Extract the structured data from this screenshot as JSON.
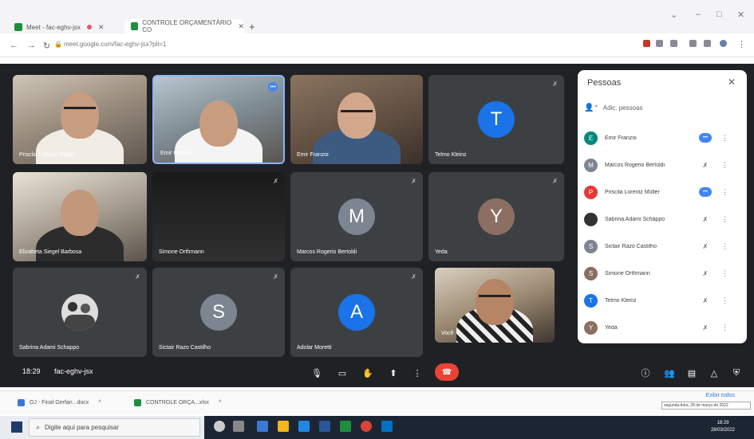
{
  "browser": {
    "tabs": [
      {
        "label": "Meet - fac-eghv-jsx",
        "active": false
      },
      {
        "label": "CONTROLE ORÇAMENTÁRIO CO",
        "active": true
      }
    ],
    "new_tab": "+",
    "url": "meet.google.com/fac-eghv-jsx?pli=1"
  },
  "tiles": [
    {
      "name": "Priscila Lorentz Müller",
      "kind": "video",
      "status": "speaking"
    },
    {
      "name": "Emir Franzoi",
      "kind": "video",
      "status": "speaking"
    },
    {
      "name": "Emir Franzoi",
      "kind": "video",
      "status": "none"
    },
    {
      "name": "Telmo Kleinz",
      "kind": "avatar",
      "initial": "T",
      "color": "#1a73e8",
      "status": "muted"
    },
    {
      "name": "Elizabeta Siegel Barbosa",
      "kind": "video",
      "status": "muted"
    },
    {
      "name": "Simone Orthmann",
      "kind": "dark",
      "status": "muted"
    },
    {
      "name": "Marcos Rogerio Bertoldi",
      "kind": "avatar",
      "initial": "M",
      "color": "#7d8591",
      "status": "muted"
    },
    {
      "name": "Yeda",
      "kind": "avatar",
      "initial": "Y",
      "color": "#8d6e63",
      "status": "muted"
    },
    {
      "name": "Sabrina Adami Schappo",
      "kind": "photo",
      "status": "muted"
    },
    {
      "name": "Sictair Razo Castilho",
      "kind": "avatar",
      "initial": "S",
      "color": "#7d8591",
      "status": "muted"
    },
    {
      "name": "Adolar Moretti",
      "kind": "avatar",
      "initial": "A",
      "color": "#1a73e8",
      "status": "muted"
    },
    {
      "name": "Você",
      "kind": "video",
      "status": "none"
    }
  ],
  "meetbar": {
    "time": "18:29",
    "code": "fac-eghv-jsx"
  },
  "people_panel": {
    "title": "Pessoas",
    "add_label": "Adic. pessoas",
    "people": [
      {
        "name": "Emir Franzoi",
        "initial": "E",
        "color": "#00897b",
        "status": "speaking"
      },
      {
        "name": "Marcos Rogerio Bertoldi",
        "initial": "M",
        "color": "#7d8591",
        "status": "muted"
      },
      {
        "name": "Priscila Lorentz Müller",
        "initial": "P",
        "color": "#e53935",
        "status": "speaking"
      },
      {
        "name": "Sabrina Adami Schappo",
        "initial": "",
        "color": "#333333",
        "status": "muted"
      },
      {
        "name": "Sictair Razo Castilho",
        "initial": "S",
        "color": "#7d8591",
        "status": "muted"
      },
      {
        "name": "Simone Orthmann",
        "initial": "S",
        "color": "#8d6e63",
        "status": "muted"
      },
      {
        "name": "Telmo Kleinz",
        "initial": "T",
        "color": "#1a73e8",
        "status": "muted"
      },
      {
        "name": "Yeda",
        "initial": "Y",
        "color": "#8d6e63",
        "status": "muted"
      }
    ]
  },
  "downloads": {
    "items": [
      {
        "label": "OJ - Final Gerfan...docx",
        "type": "doc"
      },
      {
        "label": "CONTROLE ORÇA...xlsx",
        "type": "xls"
      }
    ],
    "show_all": "Exibir todos",
    "tooltip": "segunda-feira, 28 de março de 2022"
  },
  "taskbar": {
    "search_placeholder": "Digite aqui para pesquisar",
    "clock_time": "18:29",
    "clock_date": "28/03/2022"
  }
}
